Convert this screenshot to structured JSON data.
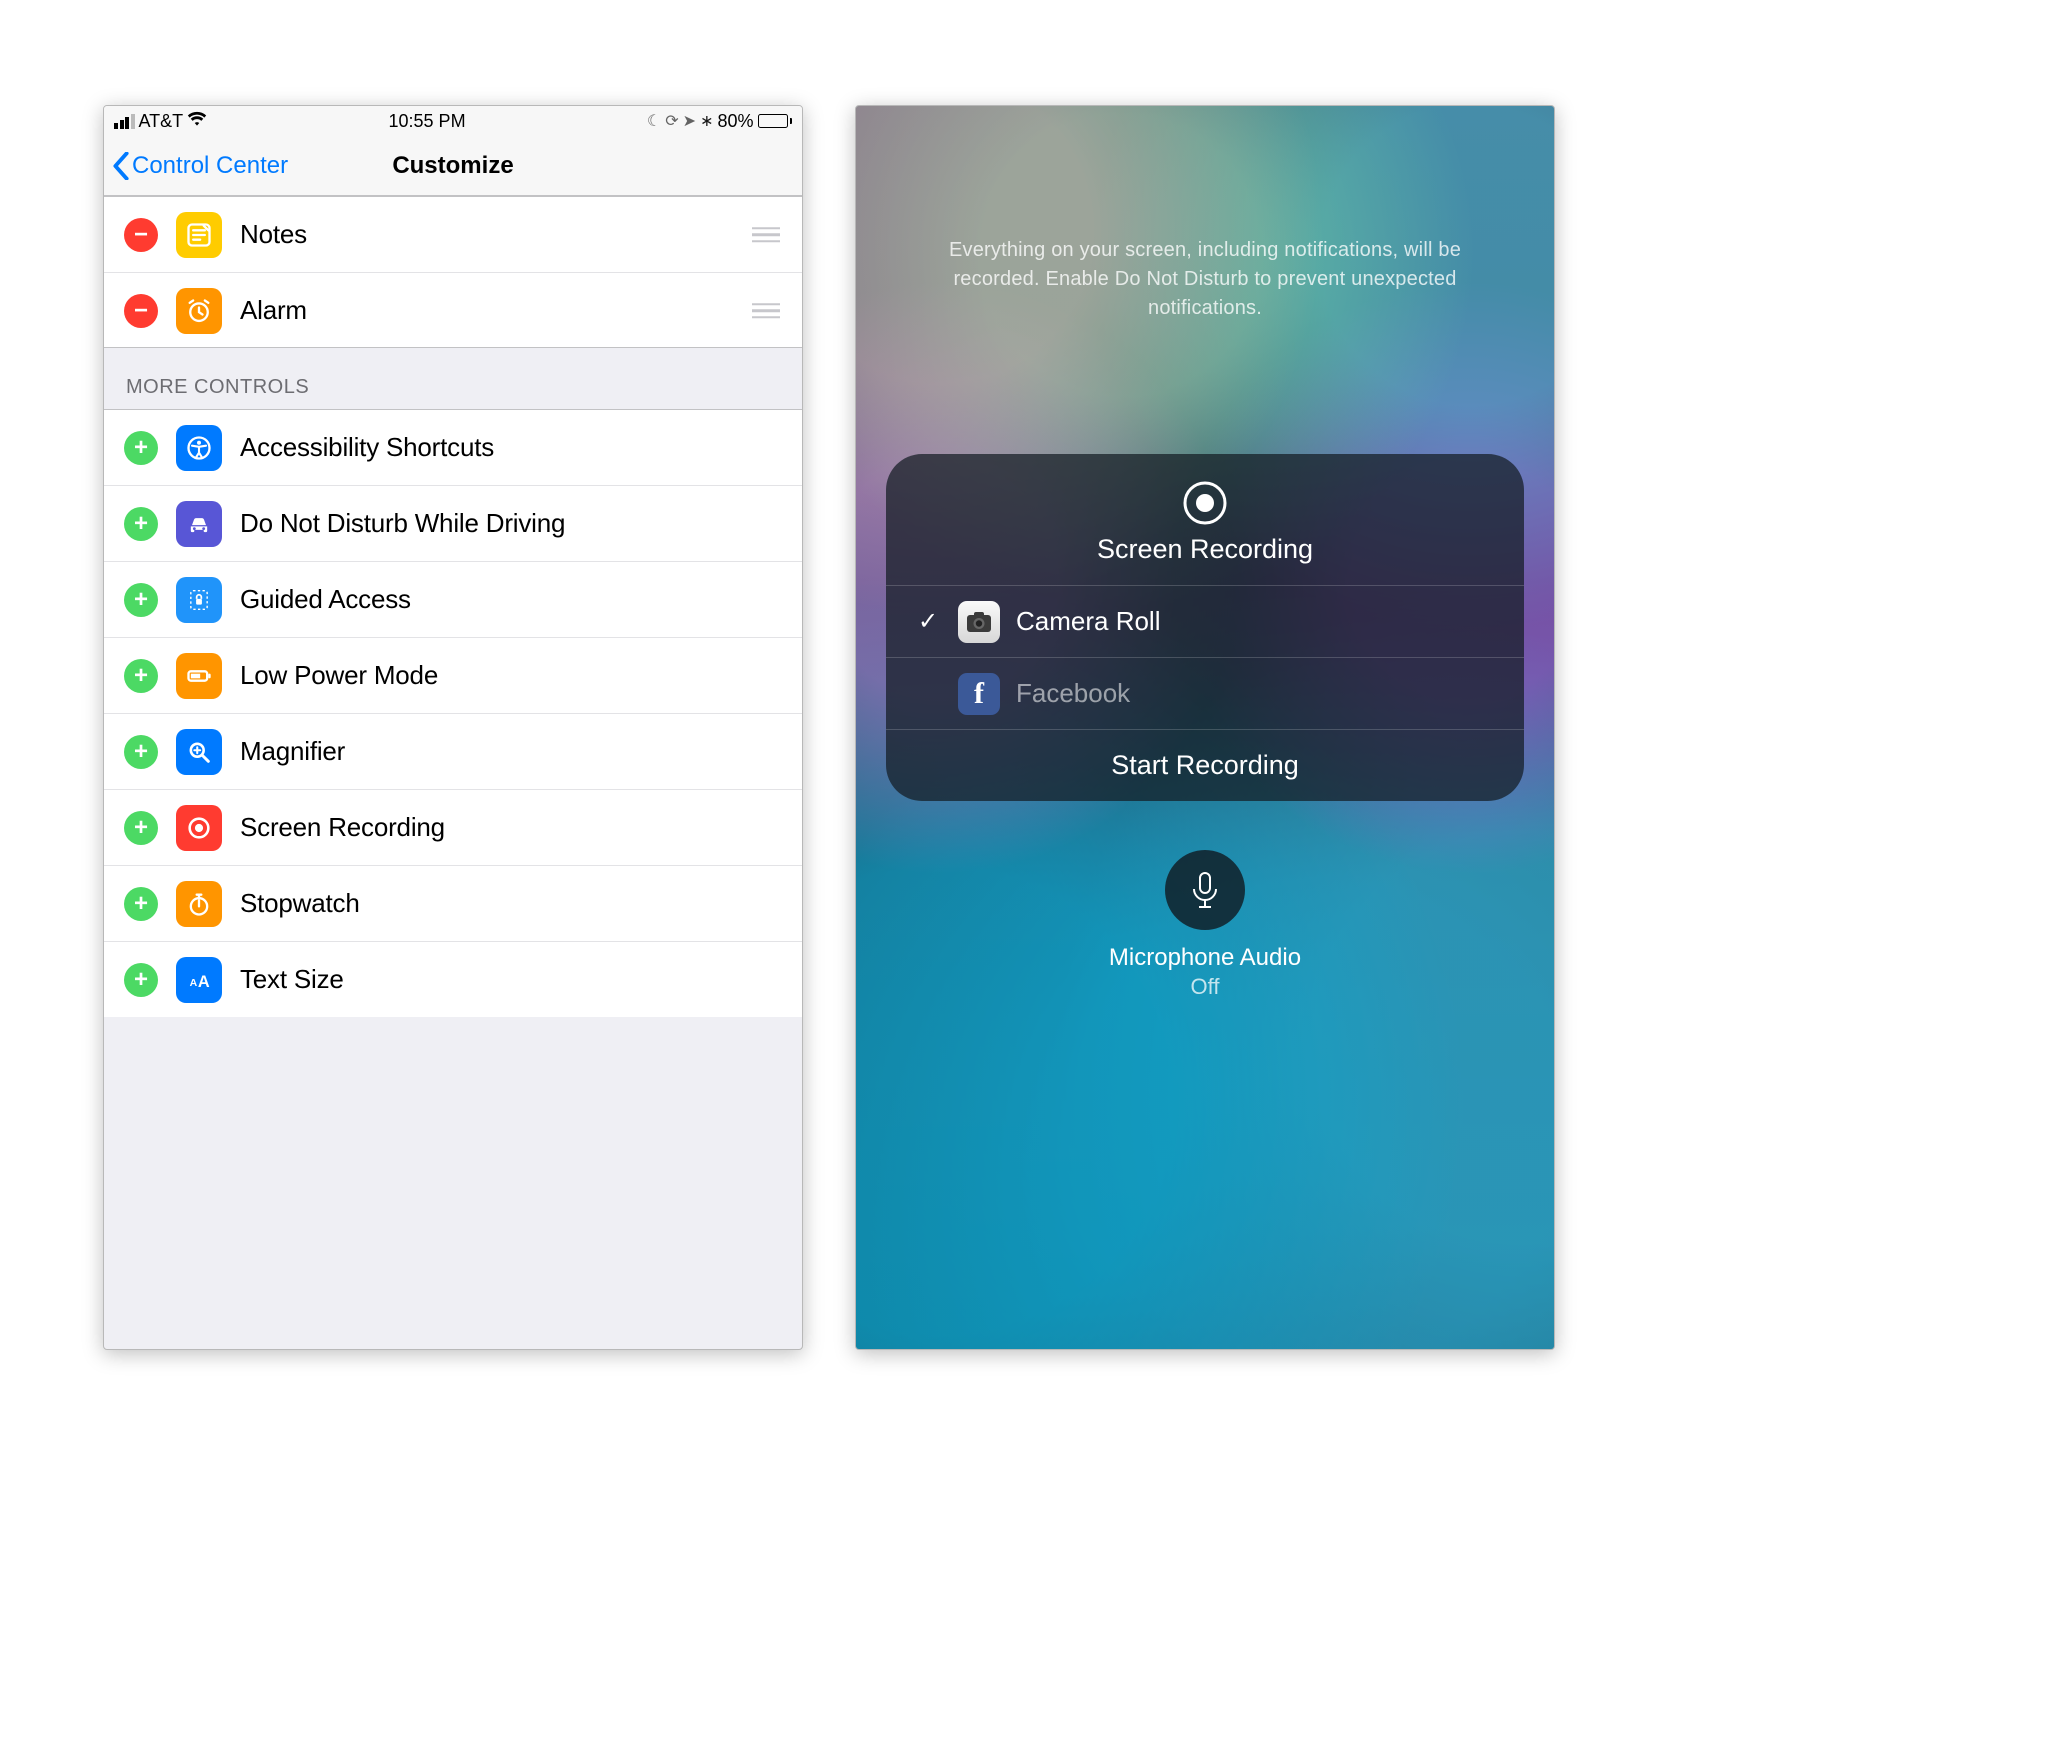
{
  "status": {
    "carrier": "AT&T",
    "time": "10:55 PM",
    "battery_pct": "80%",
    "battery_fill_pct": 80
  },
  "nav": {
    "back_label": "Control Center",
    "title": "Customize"
  },
  "included": [
    {
      "label": "Notes",
      "icon_bg": "#ffcc00",
      "icon": "notes"
    },
    {
      "label": "Alarm",
      "icon_bg": "#ff9500",
      "icon": "alarm"
    }
  ],
  "more_header": "MORE CONTROLS",
  "more": [
    {
      "label": "Accessibility Shortcuts",
      "icon_bg": "#007aff",
      "icon": "accessibility"
    },
    {
      "label": "Do Not Disturb While Driving",
      "icon_bg": "#5856d6",
      "icon": "car"
    },
    {
      "label": "Guided Access",
      "icon_bg": "#2094fa",
      "icon": "guided"
    },
    {
      "label": "Low Power Mode",
      "icon_bg": "#ff9500",
      "icon": "battery"
    },
    {
      "label": "Magnifier",
      "icon_bg": "#007aff",
      "icon": "magnifier"
    },
    {
      "label": "Screen Recording",
      "icon_bg": "#ff3b30",
      "icon": "record"
    },
    {
      "label": "Stopwatch",
      "icon_bg": "#ff9500",
      "icon": "stopwatch"
    },
    {
      "label": "Text Size",
      "icon_bg": "#007aff",
      "icon": "textsize"
    }
  ],
  "cc": {
    "info": "Everything on your screen, including notifications, will be recorded. Enable Do Not Disturb to prevent unexpected notifications.",
    "title": "Screen Recording",
    "destinations": [
      {
        "label": "Camera Roll",
        "selected": true,
        "icon": "camera"
      },
      {
        "label": "Facebook",
        "selected": false,
        "icon": "facebook"
      }
    ],
    "start_label": "Start Recording",
    "mic_label": "Microphone Audio",
    "mic_state": "Off"
  }
}
